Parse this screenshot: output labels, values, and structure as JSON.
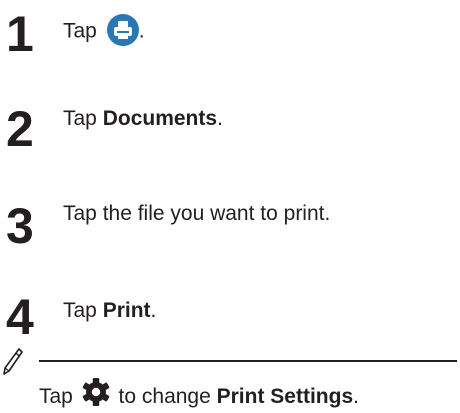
{
  "steps": [
    {
      "number": "1",
      "prefix": "Tap",
      "suffix": "."
    },
    {
      "number": "2",
      "prefix": "Tap ",
      "bold": "Documents",
      "suffix": "."
    },
    {
      "number": "3",
      "text": "Tap the file you want to print."
    },
    {
      "number": "4",
      "prefix": "Tap ",
      "bold": "Print",
      "suffix": "."
    }
  ],
  "note": {
    "prefix": "Tap",
    "middle": " to change ",
    "bold": "Print Settings",
    "suffix": "."
  },
  "icons": {
    "step1": "printer-button-icon",
    "note_marker": "pencil-note-icon",
    "note_settings": "gear-settings-icon"
  },
  "colors": {
    "text": "#231f20",
    "printer_button": "#2a78b3"
  }
}
